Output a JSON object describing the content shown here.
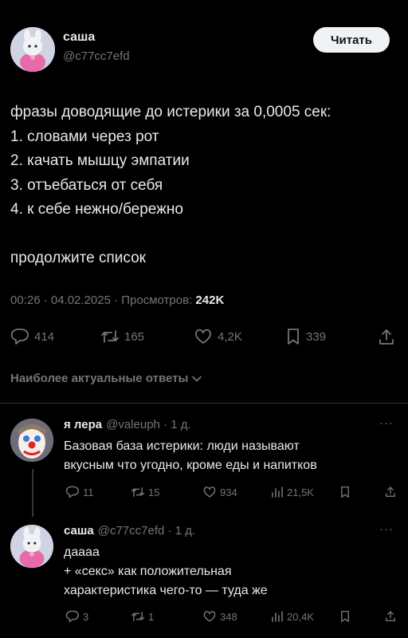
{
  "post": {
    "author_name": "саша",
    "author_handle": "@c77cc7efd",
    "read_button": "Читать",
    "text_lines": [
      "фразы доводящие до истерики за 0,0005 сек:",
      "1. словами через рот",
      "2. качать мышцу эмпатии",
      "3. отъебаться от себя",
      "4. к себе нежно/бережно",
      "",
      "продолжите список"
    ],
    "meta_time_date": "00:26 · 04.02.2025 · Просмотров: ",
    "views": "242K",
    "stats": {
      "replies": "414",
      "reposts": "165",
      "likes": "4,2K",
      "bookmarks": "339"
    }
  },
  "replies_section": {
    "title": "Наиболее актуальные ответы"
  },
  "replies": [
    {
      "name": "я лера",
      "handle_time": "@valeuph · 1 д.",
      "more": "···",
      "text_lines": [
        "Базовая база истерики: люди называют",
        "вкусным что угодно, кроме еды и напитков"
      ],
      "replies": "11",
      "reposts": "15",
      "likes": "934",
      "views": "21,5K"
    },
    {
      "name": "саша",
      "handle_time": "@c77cc7efd · 1 д.",
      "more": "···",
      "text_lines": [
        "даааа",
        "+ «секс» как положительная",
        "характеристика чего-то — туда же"
      ],
      "replies": "3",
      "reposts": "1",
      "likes": "348",
      "views": "20,4K"
    }
  ],
  "colors": {
    "background": "#000000",
    "text": "#e7e9ea",
    "secondary": "#71767b",
    "button_bg": "#eff3f4"
  }
}
